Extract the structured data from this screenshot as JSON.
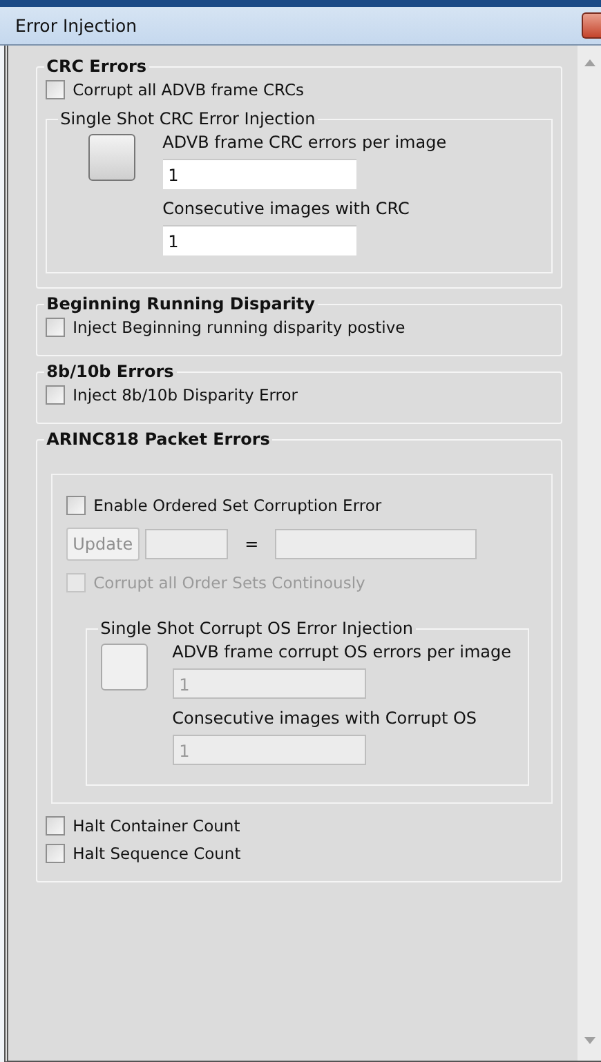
{
  "window": {
    "title": "Error Injection"
  },
  "sections": [
    {
      "title": "CRC Errors",
      "items": [
        {
          "kind": "checkbox",
          "label": "Corrupt all ADVB frame CRCs",
          "checked": false,
          "disabled": false
        },
        {
          "kind": "group",
          "title": "Single Shot CRC Error Injection",
          "disabled": false,
          "fields": [
            {
              "label": "ADVB frame CRC errors per image",
              "value": "1"
            },
            {
              "label": "Consecutive images with CRC",
              "value": "1"
            }
          ]
        }
      ]
    },
    {
      "title": "Beginning Running Disparity",
      "items": [
        {
          "kind": "checkbox",
          "label": "Inject Beginning running disparity postive",
          "checked": false,
          "disabled": false
        }
      ]
    },
    {
      "title": "8b/10b Errors",
      "items": [
        {
          "kind": "checkbox",
          "label": "Inject 8b/10b Disparity Error",
          "checked": false,
          "disabled": false
        }
      ]
    },
    {
      "title": "ARINC818 Packet Errors",
      "items": [
        {
          "kind": "panel",
          "items": [
            {
              "kind": "checkbox",
              "label": "Enable Ordered Set Corruption Error",
              "checked": false,
              "disabled": false
            },
            {
              "kind": "update_row",
              "button": "Update",
              "operator": "=",
              "disabled": true
            },
            {
              "kind": "checkbox",
              "label": "Corrupt all Order Sets Continously",
              "checked": false,
              "disabled": true
            },
            {
              "kind": "group",
              "title": "Single Shot Corrupt OS Error Injection",
              "disabled": true,
              "fields": [
                {
                  "label": "ADVB frame corrupt OS errors per image",
                  "value": "1"
                },
                {
                  "label": "Consecutive images with Corrupt OS",
                  "value": "1"
                }
              ]
            }
          ]
        },
        {
          "kind": "checkbox",
          "label": "Halt Container Count",
          "checked": false,
          "disabled": false
        },
        {
          "kind": "checkbox",
          "label": "Halt Sequence Count",
          "checked": false,
          "disabled": false
        }
      ]
    }
  ]
}
